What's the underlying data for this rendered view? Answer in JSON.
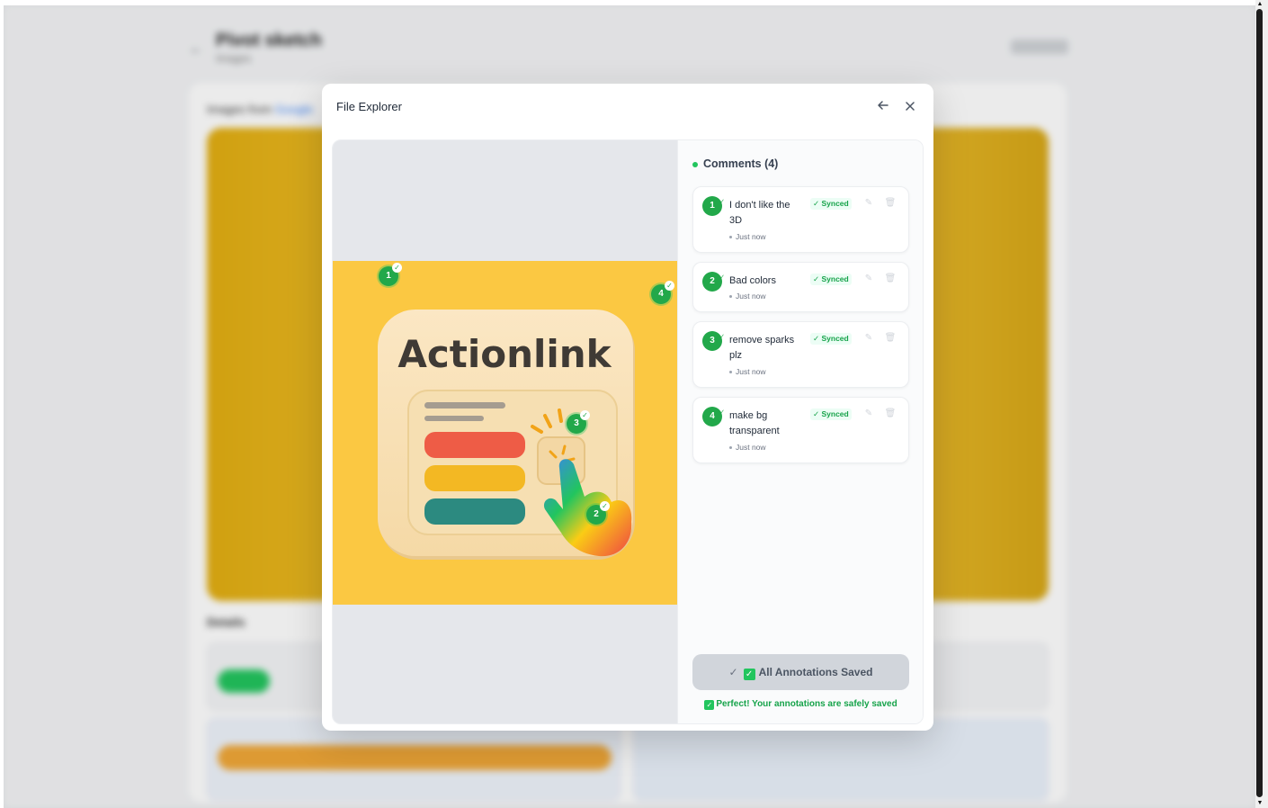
{
  "background": {
    "title": "Pivot sketch",
    "subtitle": "Images",
    "images_label": "Images from",
    "images_link": "Google",
    "details_label": "Details"
  },
  "modal": {
    "title": "File Explorer",
    "back_icon": "arrow-left-icon",
    "close_icon": "close-icon"
  },
  "artwork": {
    "logo_text": "Actionlink",
    "background_color": "#fbc842"
  },
  "comments": {
    "header": "Comments (4)",
    "items": [
      {
        "number": "1",
        "text": "I don't like the 3D",
        "status": "✓ Synced",
        "time": "Just now"
      },
      {
        "number": "2",
        "text": "Bad colors",
        "status": "✓ Synced",
        "time": "Just now"
      },
      {
        "number": "3",
        "text": "remove sparks plz",
        "status": "✓ Synced",
        "time": "Just now"
      },
      {
        "number": "4",
        "text": "make bg transparent",
        "status": "✓ Synced",
        "time": "Just now"
      }
    ]
  },
  "pins": [
    {
      "number": "1"
    },
    {
      "number": "2"
    },
    {
      "number": "3"
    },
    {
      "number": "4"
    }
  ],
  "footer": {
    "saved_button_label": "All Annotations Saved",
    "saved_note": "Perfect! Your annotations are safely saved"
  },
  "colors": {
    "accent_green": "#22a84a",
    "synced_green": "#16a34a",
    "saved_button_bg": "#d1d5db"
  }
}
